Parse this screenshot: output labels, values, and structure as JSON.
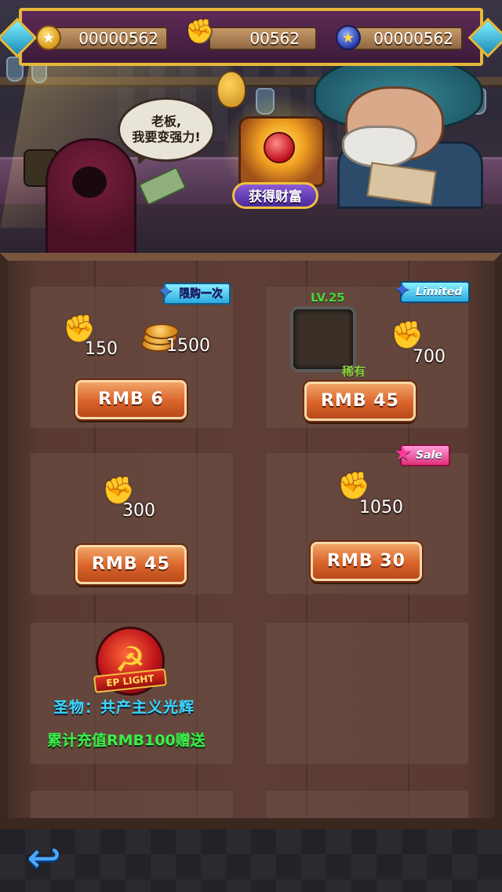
{
  "hud": {
    "coins": "00000562",
    "fists": "00562",
    "gems": "00000562",
    "coin_icon": "coin-icon",
    "fist_icon": "fist-icon",
    "gem_icon": "star-gem-icon"
  },
  "scene": {
    "speech_line1": "老板,",
    "speech_line2": "我要变强力!",
    "wealth_button": "获得财富"
  },
  "shop": {
    "items": [
      {
        "tag": "限购一次",
        "fist_qty": "150",
        "gold_qty": "1500",
        "price": "RMB   6"
      },
      {
        "tag": "Limited",
        "hero_level": "LV.25",
        "hero_rarity": "稀有",
        "fist_qty": "700",
        "price": "RMB  45"
      },
      {
        "fist_qty": "300",
        "price": "RMB  45"
      },
      {
        "tag": "Sale",
        "fist_qty": "1050",
        "price": "RMB  30"
      },
      {
        "relic_badge": "EP LIGHT",
        "relic_name": "圣物：共产主义光辉",
        "relic_note": "累计充值RMB100赠送"
      }
    ]
  },
  "footer": {
    "back_icon": "back-arrow-icon"
  },
  "colors": {
    "hud_border": "#e6b83a",
    "buy_button": "#d9632a",
    "relic_name": "#3ad8ff",
    "relic_note": "#3af04a",
    "hero_level": "#49d53a"
  }
}
